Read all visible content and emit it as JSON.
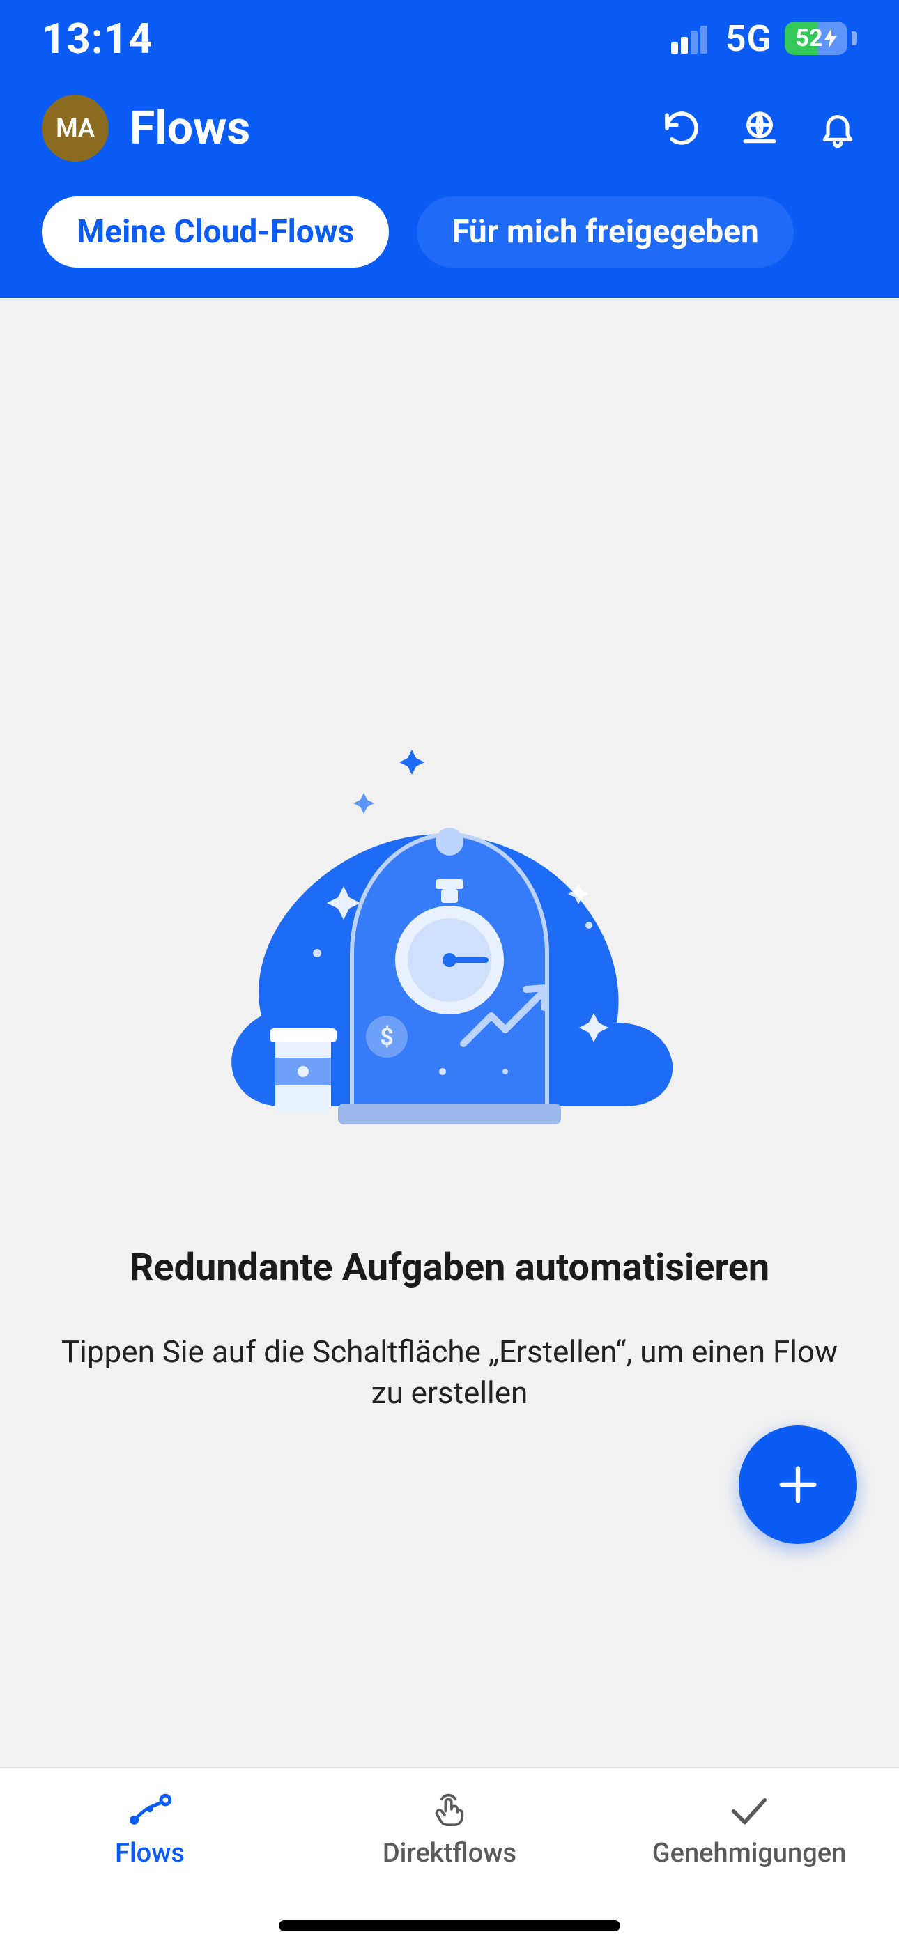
{
  "status_bar": {
    "time": "13:14",
    "network_label": "5G",
    "battery_percent": "52"
  },
  "header": {
    "avatar_initials": "MA",
    "title": "Flows"
  },
  "tabs": {
    "active": "Meine Cloud-Flows",
    "inactive": "Für mich freigegeben"
  },
  "empty_state": {
    "title": "Redundante Aufgaben automatisieren",
    "subtitle": "Tippen Sie auf die Schaltfläche „Erstellen“, um einen Flow zu erstellen"
  },
  "bottom_nav": {
    "items": [
      {
        "label": "Flows"
      },
      {
        "label": "Direktflows"
      },
      {
        "label": "Genehmigungen"
      }
    ]
  }
}
